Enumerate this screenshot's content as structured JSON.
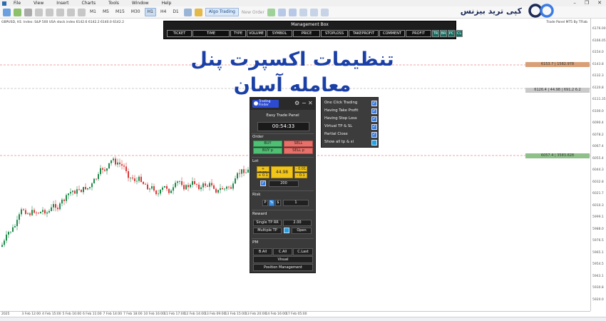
{
  "menu": {
    "items": [
      "File",
      "View",
      "Insert",
      "Charts",
      "Tools",
      "Window",
      "Help"
    ]
  },
  "toolbar": {
    "timeframes": [
      "M1",
      "M5",
      "M15",
      "M30",
      "H1",
      "H4",
      "D1"
    ],
    "active_timeframe": "H1",
    "algo_trading": "Algo Trading",
    "new_order": "New Order"
  },
  "logo": {
    "text": "کپی ترید بیزنس"
  },
  "chart": {
    "symbol_info": "GBPUSD, H1:  Index: S&P 500 USA stock index  6142.6 6142.2 6140.0 6142.2",
    "ea_label": "Trade Panel MT5 By TFlab",
    "price_labels": [
      "6176.00",
      "6166.05",
      "6154.0",
      "6143.8",
      "6132.3",
      "6120.8",
      "6111.35",
      "6100.0",
      "6090.4",
      "6078.2",
      "6067.4",
      "6055.4",
      "6044.3",
      "6032.8",
      "6021.7",
      "6010.3",
      "5999.1",
      "5988.0",
      "5976.5",
      "5965.1",
      "5954.5",
      "5943.1",
      "5930.8",
      "5920.0"
    ],
    "time_labels": [
      "2025",
      "3 Feb 12:00",
      "4 Feb 15:00",
      "5 Feb 16:00",
      "6 Feb 11:00",
      "7 Feb 14:00",
      "7 Feb 18:00",
      "10 Feb 16:00",
      "11 Feb 17:00",
      "12 Feb 14:00",
      "13 Feb 09:00",
      "13 Feb 15:00",
      "13 Feb 20:00",
      "14 Feb 16:00",
      "17 Feb 05:00"
    ],
    "levels": [
      {
        "label": "6153.7 | 1582.978",
        "color": "#d9a077"
      },
      {
        "label": "6126.4 | 44.98 | 691.2 6.2",
        "color": "#c9c9c9"
      },
      {
        "label": "6057.4 | 3583.828",
        "color": "#8fc08a"
      }
    ],
    "colors": {
      "bull": "#1f8a4c",
      "bear": "#d83a3a",
      "level_line": "#d94a4a"
    }
  },
  "headline": "تنظیمات اکسپرت پنل معامله آسان",
  "management": {
    "title": "Management Box",
    "columns": [
      "TICKET",
      "TIME",
      "TYPE",
      "VOLUME",
      "SYMBOL",
      "PRICE",
      "STOPLOSS",
      "TAKEPROFIT",
      "COMMENT",
      "PROFIT"
    ],
    "buttons": [
      "TR",
      "BR",
      "PC",
      "CL"
    ]
  },
  "panel": {
    "brand": "Trading Finder",
    "title": "Easy Trade Panel",
    "timer": "00:54:33",
    "order_label": "Order",
    "buy": "BUY",
    "sell": "SELL",
    "buy_p": "BUY p",
    "sell_p": "SELL p",
    "lot_label": "Lot",
    "lot_plus_001": "+ 0.01",
    "lot_plus_01": "+ 0.1",
    "lot_value": "44.98",
    "lot_minus_001": "- 0.01",
    "lot_minus_01": "- 0.1",
    "lot_qty": "200",
    "risk_label": "Risk",
    "risk_p": "P",
    "risk_pct": "%",
    "risk_dollar": "$",
    "risk_value": "1",
    "reward_label": "Reward",
    "single_tp": "Single TP RR",
    "single_tp_value": "2.00",
    "multiple_tp": "Multiple TP",
    "multiple_tp_open": "Open",
    "pm_label": "PM",
    "b_all": "B.All",
    "c_all": "C.All",
    "c_last": "C.Last",
    "visual": "Visual",
    "position_mgmt": "Position Management"
  },
  "options": {
    "items": [
      {
        "label": "One Click Trading",
        "checked": true
      },
      {
        "label": "Having Take Profit",
        "checked": true
      },
      {
        "label": "Having Stop Loss",
        "checked": true
      },
      {
        "label": "Virtual TP & SL",
        "checked": true
      },
      {
        "label": "Partial Close",
        "checked": true
      },
      {
        "label": "Show all tp & sl",
        "checked": false
      }
    ]
  }
}
